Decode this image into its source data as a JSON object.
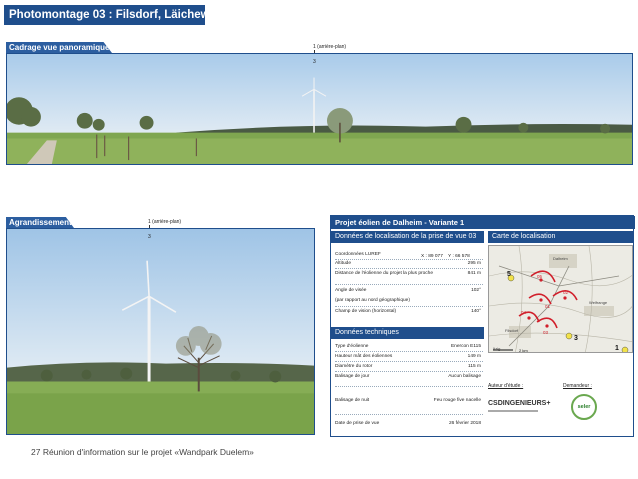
{
  "page_title": "Photomontage 03 : Filsdorf, Läichewee",
  "panorama": {
    "tab_label": "Cadrage vue panoramique",
    "marker_label": "1 (arrière-plan)",
    "marker_sub": "3"
  },
  "zoom": {
    "tab_label": "Agrandissement",
    "marker_label": "1 (arrière-plan)",
    "marker_sub": "3"
  },
  "info": {
    "title": "Projet éolien de Dalheim - Variante 1",
    "location_header": "Données de localisation de la prise de vue 03",
    "map_header": "Carte de localisation",
    "coords_label": "Coordonnées LUREF",
    "coord_x": "X : 89 077",
    "coord_y": "Y : 66 578",
    "location_rows": [
      {
        "label": "Altitude",
        "value": "295 m"
      },
      {
        "label": "Distance de l'éolienne du projet la plus proche",
        "value": "841 m"
      },
      {
        "label": "Angle de visée",
        "value": "102°"
      },
      {
        "label": "(par rapport au nord géographique)",
        "value": ""
      },
      {
        "label": "Champ de vision (horizontal)",
        "value": "140°"
      }
    ],
    "tech_header": "Données techniques",
    "tech_rows": [
      {
        "label": "Type d'éolienne",
        "value": "Enercon E115"
      },
      {
        "label": "Hauteur mât des éoliennes",
        "value": "149 m"
      },
      {
        "label": "Diamètre du rotor",
        "value": "115 m"
      },
      {
        "label": "Balisage de jour",
        "value": "Aucun balisage"
      },
      {
        "label": "Balisage de nuit",
        "value": "Feu rouge five nacelle"
      },
      {
        "label": "Date de prise de vue",
        "value": "26 février 2018"
      }
    ],
    "author_label": "Auteur d'étude :",
    "client_label": "Demandeur :",
    "author_logo": "CSDINGENIEURS+",
    "client_logo": "seler",
    "map_labels": {
      "town1": "Dalheim",
      "town2": "Filsdorf",
      "town3": "Welfrange",
      "town4": "Itzig",
      "n5": "5",
      "n3": "3",
      "n1": "1",
      "t01": "01",
      "t02": "02",
      "t03": "03",
      "t04": "04",
      "t05": "05",
      "scale": "2 km"
    }
  },
  "footer": {
    "text": "27   Réunion d'information sur le projet «Wandpark Duelem»"
  }
}
